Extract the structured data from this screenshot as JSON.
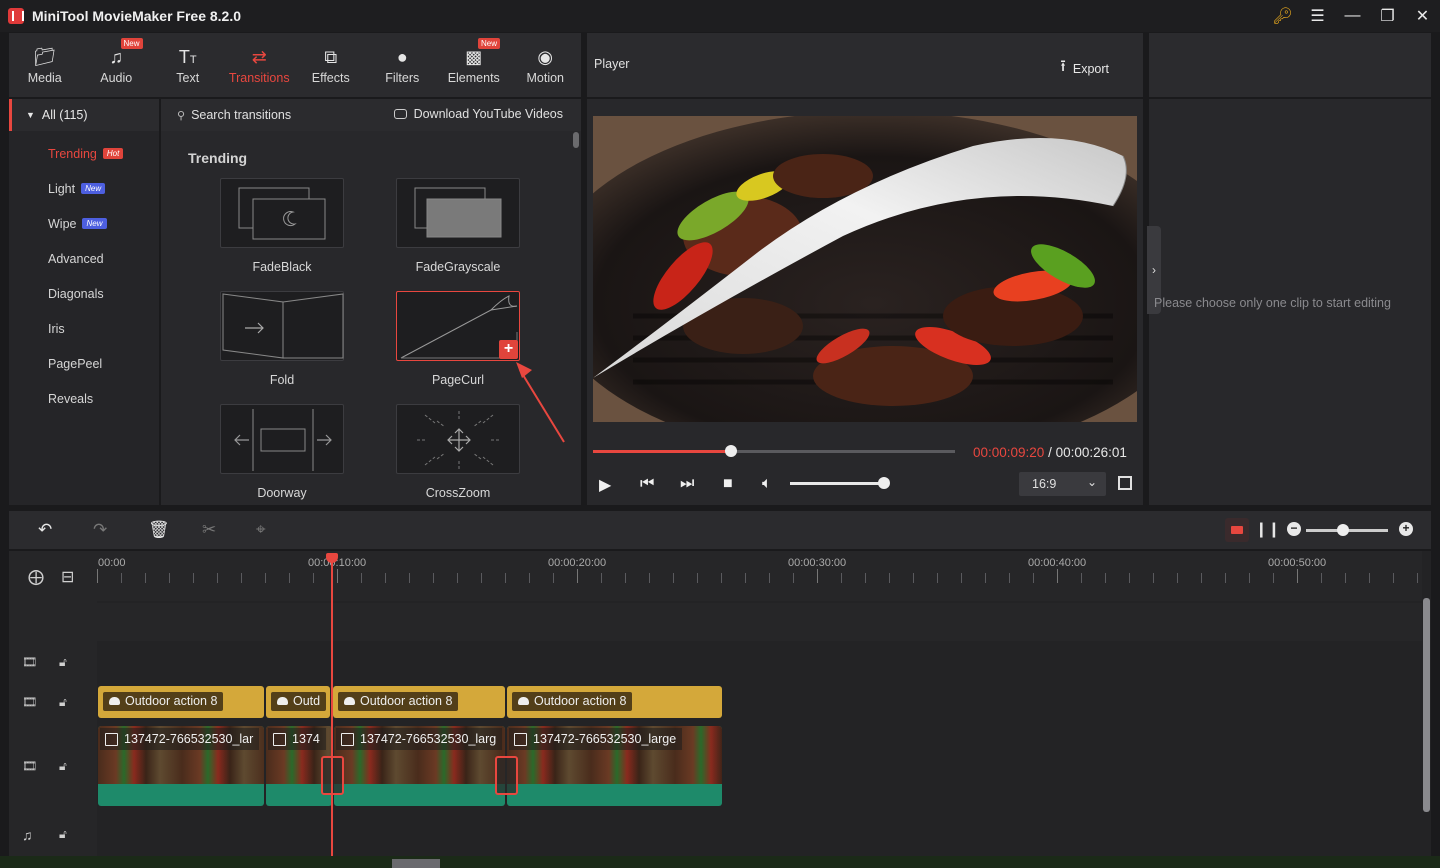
{
  "app": {
    "title": "MiniTool MovieMaker Free 8.2.0"
  },
  "nav": {
    "items": [
      {
        "label": "Media",
        "icon": "folder-icon",
        "badge": ""
      },
      {
        "label": "Audio",
        "icon": "music-note-icon",
        "badge": "New"
      },
      {
        "label": "Text",
        "icon": "text-icon",
        "badge": ""
      },
      {
        "label": "Transitions",
        "icon": "transitions-icon",
        "badge": ""
      },
      {
        "label": "Effects",
        "icon": "effects-icon",
        "badge": ""
      },
      {
        "label": "Filters",
        "icon": "filters-icon",
        "badge": ""
      },
      {
        "label": "Elements",
        "icon": "elements-icon",
        "badge": "New"
      },
      {
        "label": "Motion",
        "icon": "motion-icon",
        "badge": ""
      }
    ],
    "active": "Transitions"
  },
  "player": {
    "label": "Player",
    "export_label": "Export"
  },
  "categories": {
    "all_label": "All (115)",
    "items": [
      {
        "label": "Trending",
        "badge": "Hot"
      },
      {
        "label": "Light",
        "badge": "New"
      },
      {
        "label": "Wipe",
        "badge": "New"
      },
      {
        "label": "Advanced",
        "badge": ""
      },
      {
        "label": "Diagonals",
        "badge": ""
      },
      {
        "label": "Iris",
        "badge": ""
      },
      {
        "label": "PagePeel",
        "badge": ""
      },
      {
        "label": "Reveals",
        "badge": ""
      }
    ]
  },
  "search": {
    "placeholder": "Search transitions",
    "download_label": "Download YouTube Videos"
  },
  "gallery": {
    "section_title": "Trending",
    "tiles": [
      "FadeBlack",
      "FadeGrayscale",
      "Fold",
      "PageCurl",
      "Doorway",
      "CrossZoom"
    ],
    "selected": "PageCurl"
  },
  "playback": {
    "current_time": "00:00:09:20",
    "separator": "/",
    "total_time": "00:00:26:01",
    "progress_fraction": 0.38,
    "volume_fraction": 1.0,
    "aspect_ratio": "16:9"
  },
  "properties": {
    "message": "Please choose only one clip to start editing"
  },
  "timeline": {
    "ruler_labels": [
      "00:00",
      "00:00:10:00",
      "00:00:20:00",
      "00:00:30:00",
      "00:00:40:00",
      "00:00:50:00"
    ],
    "zoom_fraction": 0.45,
    "audio_clips": [
      "Outdoor action 8",
      "Outd",
      "Outdoor action 8",
      "Outdoor action 8"
    ],
    "video_clips": [
      "137472-766532530_lar",
      "1374",
      "137472-766532530_larg",
      "137472-766532530_large"
    ]
  },
  "colors": {
    "accent": "#e8473f",
    "audio_clip": "#d4a83a",
    "video_clip": "#1e8a6a"
  }
}
